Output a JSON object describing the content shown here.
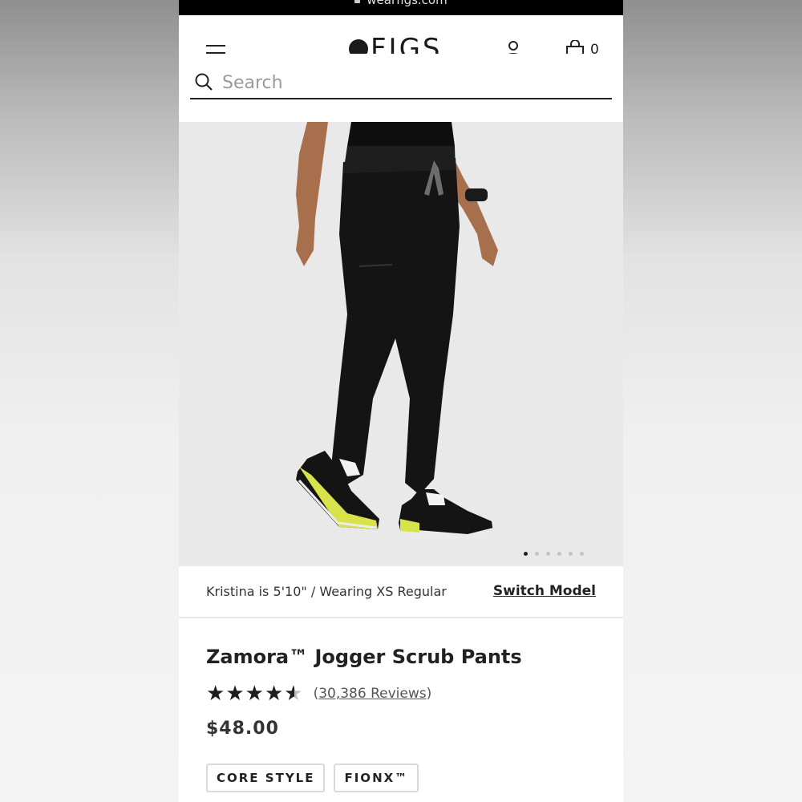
{
  "browser": {
    "url": "wearfigs.com"
  },
  "header": {
    "logo_text": "FIGS",
    "bag_count": "0"
  },
  "search": {
    "placeholder": "Search",
    "value": ""
  },
  "carousel": {
    "image": "woman-wearing-black-jogger-scrub-pants-and-sneakers",
    "total_slides": 6,
    "active_slide": 1
  },
  "model_info": {
    "text": "Kristina is 5'10\" / Wearing XS Regular",
    "switch_label": "Switch Model"
  },
  "product": {
    "title": "Zamora™ Jogger Scrub Pants",
    "rating": 4.5,
    "reviews_open": "(",
    "reviews_label": "30,386 Reviews",
    "reviews_close": ")",
    "price": "$48.00",
    "tags": [
      "CORE STYLE",
      "FIONX™"
    ]
  },
  "colors": {
    "accent": "#222222",
    "hero_bg": "#e9e9ea"
  }
}
